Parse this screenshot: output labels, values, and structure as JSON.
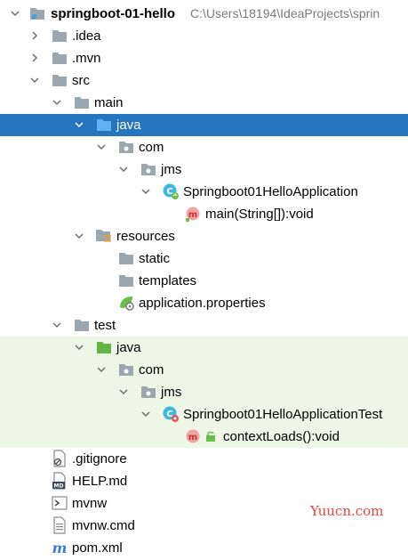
{
  "project": {
    "name": "springboot-01-hello",
    "path": "C:\\Users\\18194\\IdeaProjects\\sprin"
  },
  "tree": {
    "idea": ".idea",
    "mvn": ".mvn",
    "src": "src",
    "main": "main",
    "main_java": "java",
    "main_com": "com",
    "main_jms": "jms",
    "app_class": "Springboot01HelloApplication",
    "main_method": "main(String[]):void",
    "resources": "resources",
    "static": "static",
    "templates": "templates",
    "app_props": "application.properties",
    "test": "test",
    "test_java": "java",
    "test_com": "com",
    "test_jms": "jms",
    "test_class": "Springboot01HelloApplicationTest",
    "context_loads": "contextLoads():void",
    "gitignore": ".gitignore",
    "help": "HELP.md",
    "mvnw": "mvnw",
    "mvnw_cmd": "mvnw.cmd",
    "pom": "pom.xml"
  },
  "watermark": "Yuucn.com",
  "colors": {
    "selection": "#2675bf",
    "test_background": "#eef6e6",
    "folder": "#9aa7b0",
    "source_folder": "#4a9fe0",
    "test_folder": "#62b543",
    "watermark": "#e8453c"
  }
}
